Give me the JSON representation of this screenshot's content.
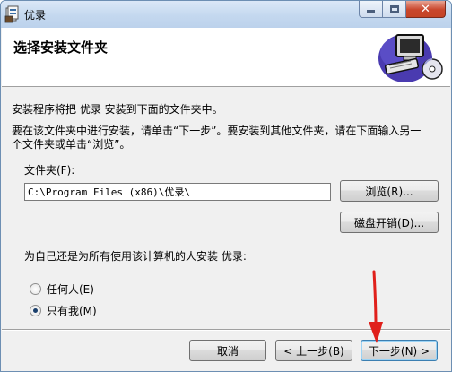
{
  "window": {
    "title": "优录",
    "close_glyph": "✕",
    "icons": [
      "app-icon",
      "minimize-icon",
      "maximize-icon",
      "close-icon"
    ]
  },
  "banner": {
    "heading": "选择安装文件夹",
    "art_icon": "computer-cd-icon"
  },
  "body": {
    "intro": "安装程序将把 优录 安装到下面的文件夹中。",
    "instructions_line1": "要在该文件夹中进行安装，请单击“下一步”。要安装到其他文件夹，请在下面输入另一",
    "instructions_line2": "个文件夹或单击“浏览”。"
  },
  "folder": {
    "label": "文件夹(F):",
    "value": "C:\\Program Files (x86)\\优录\\",
    "browse_label": "浏览(R)...",
    "disk_cost_label": "磁盘开销(D)..."
  },
  "install_for": {
    "question": "为自己还是为所有使用该计算机的人安装 优录:",
    "options": [
      {
        "label": "任何人(E)",
        "selected": false
      },
      {
        "label": "只有我(M)",
        "selected": true
      }
    ]
  },
  "footer": {
    "cancel_label": "取消",
    "back_label": "< 上一步(B)",
    "next_label": "下一步(N) >"
  },
  "colors": {
    "annotation_arrow": "#e0201b",
    "window_border": "#6d8fb3",
    "close_button": "#c9462c"
  }
}
